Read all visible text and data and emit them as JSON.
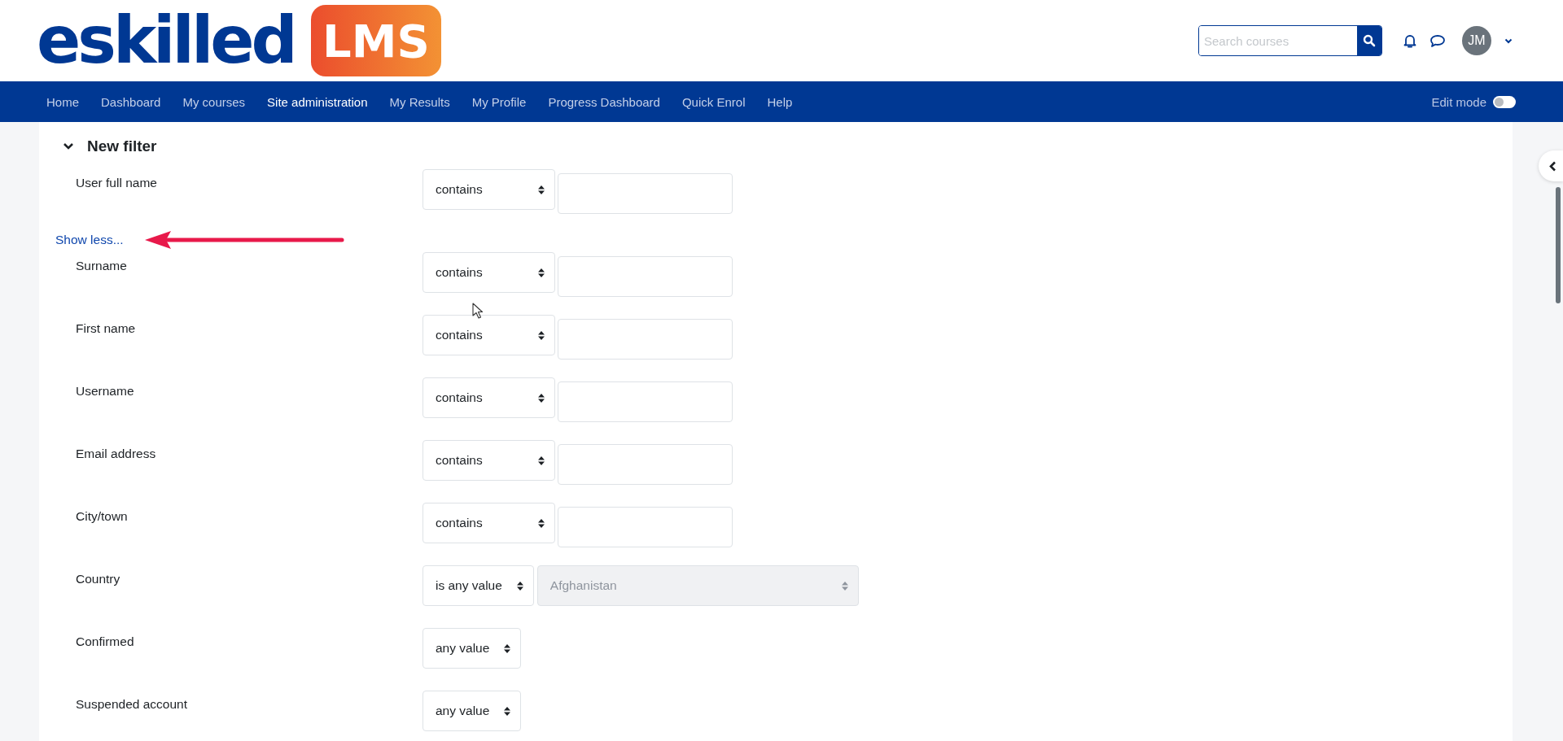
{
  "logo": {
    "wordmark": "eskilled",
    "badge": "LMS"
  },
  "search": {
    "placeholder": "Search courses"
  },
  "user": {
    "initials": "JM"
  },
  "nav": [
    {
      "label": "Home",
      "selected": false
    },
    {
      "label": "Dashboard",
      "selected": false
    },
    {
      "label": "My courses",
      "selected": false
    },
    {
      "label": "Site administration",
      "selected": true
    },
    {
      "label": "My Results",
      "selected": false
    },
    {
      "label": "My Profile",
      "selected": false
    },
    {
      "label": "Progress Dashboard",
      "selected": false
    },
    {
      "label": "Quick Enrol",
      "selected": false
    },
    {
      "label": "Help",
      "selected": false
    }
  ],
  "edit_mode": {
    "label": "Edit mode",
    "on": false
  },
  "section": {
    "title": "New filter",
    "expanded": true
  },
  "show_less": "Show less...",
  "filters": [
    {
      "label": "User full name",
      "kind": "text",
      "operator": "contains"
    },
    {
      "label": "Surname",
      "kind": "text",
      "operator": "contains"
    },
    {
      "label": "First name",
      "kind": "text",
      "operator": "contains"
    },
    {
      "label": "Username",
      "kind": "text",
      "operator": "contains"
    },
    {
      "label": "Email address",
      "kind": "text",
      "operator": "contains"
    },
    {
      "label": "City/town",
      "kind": "text",
      "operator": "contains"
    },
    {
      "label": "Country",
      "kind": "choice",
      "operator": "is any value",
      "value": "Afghanistan",
      "disabled": true
    },
    {
      "label": "Confirmed",
      "kind": "select",
      "operator": "any value"
    },
    {
      "label": "Suspended account",
      "kind": "select",
      "operator": "any value"
    }
  ]
}
